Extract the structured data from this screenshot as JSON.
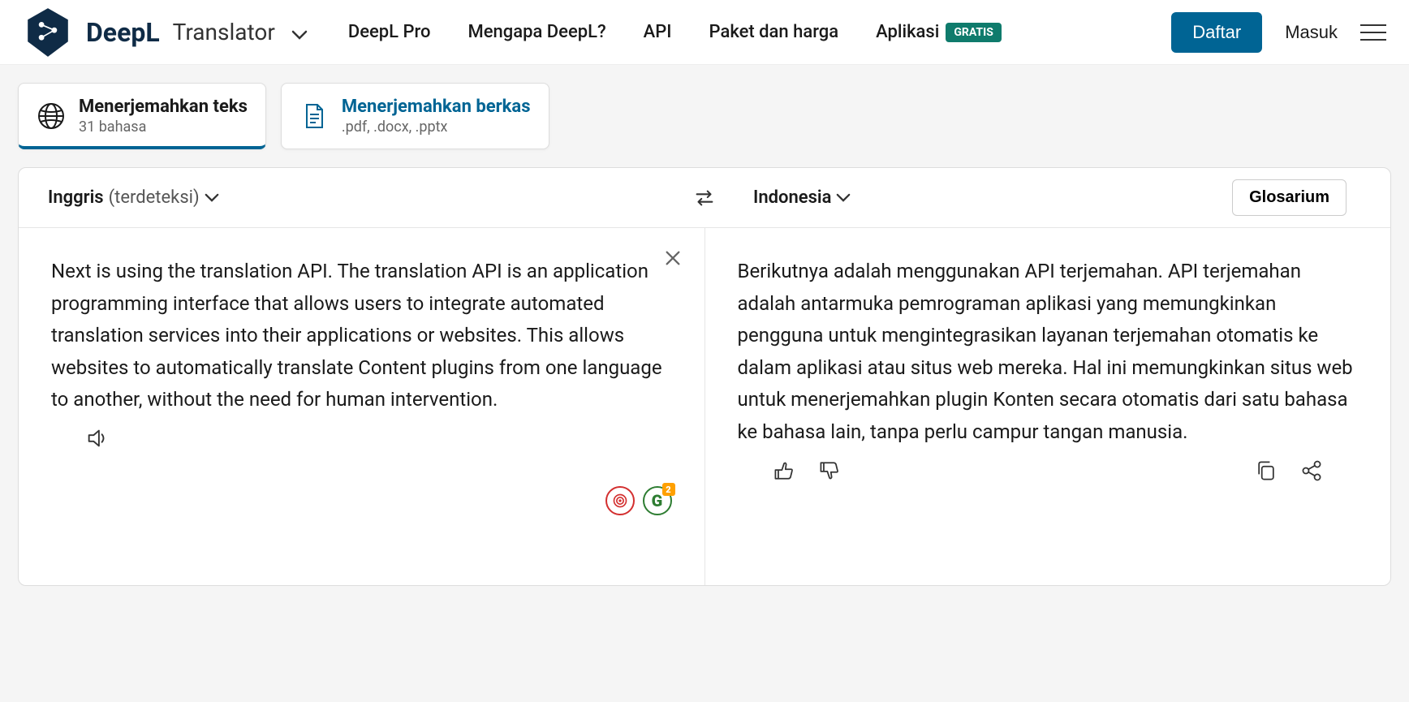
{
  "header": {
    "brand": "DeepL",
    "product": "Translator",
    "nav": {
      "pro": "DeepL Pro",
      "why": "Mengapa DeepL?",
      "api": "API",
      "pricing": "Paket dan harga",
      "apps": "Aplikasi",
      "apps_badge": "GRATIS"
    },
    "signup": "Daftar",
    "login": "Masuk"
  },
  "tabs": {
    "text": {
      "title": "Menerjemahkan teks",
      "sub": "31 bahasa"
    },
    "files": {
      "title": "Menerjemahkan berkas",
      "sub": ".pdf, .docx, .pptx"
    }
  },
  "languages": {
    "source_name": "Inggris",
    "source_detected": "(terdeteksi)",
    "target_name": "Indonesia",
    "glossary": "Glosarium"
  },
  "source_text": "Next is using the translation API. The translation API is an application programming interface that allows users to integrate automated translation services into their applications or websites. This allows websites to automatically translate Content plugins from one language to another, without the need for human intervention.",
  "target_text": "Berikutnya adalah menggunakan API terjemahan. API terjemahan adalah antarmuka pemrograman aplikasi yang memungkinkan pengguna untuk mengintegrasikan layanan terjemahan otomatis ke dalam aplikasi atau situs web mereka. Hal ini memungkinkan situs web untuk menerjemahkan plugin Konten secara otomatis dari satu bahasa ke bahasa lain, tanpa perlu campur tangan manusia.",
  "ext_badge_count": "2"
}
